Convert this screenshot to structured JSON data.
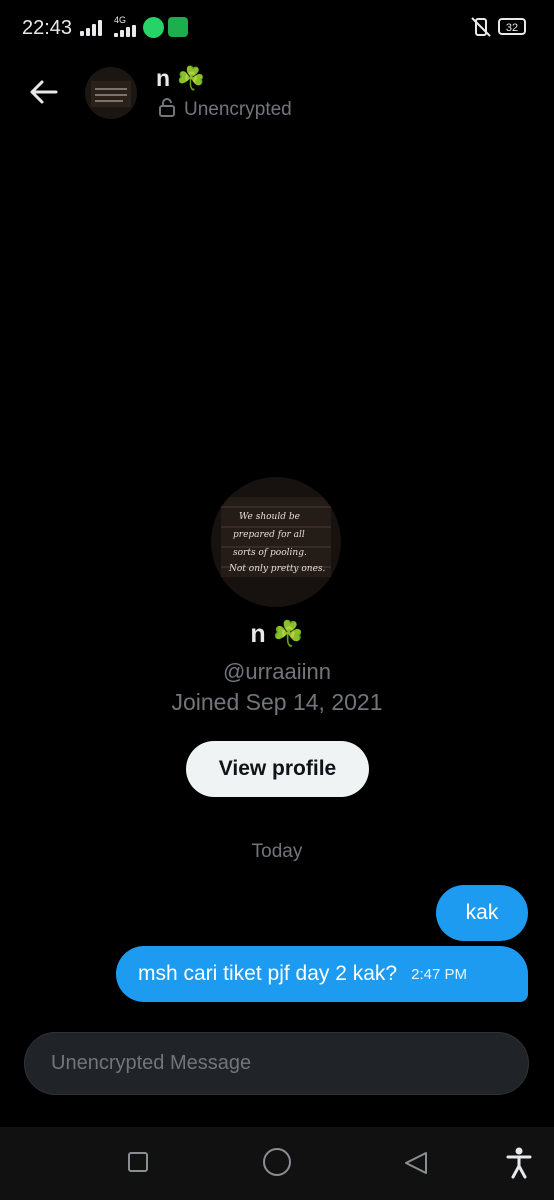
{
  "status_bar": {
    "time": "22:43",
    "network": "4G",
    "battery": "32",
    "icons": [
      "signal-bars-icon",
      "whatsapp-icon",
      "shield-app-icon",
      "mute-vibrate-icon",
      "battery-icon"
    ]
  },
  "header": {
    "name": "n ☘️",
    "encryption_status": "Unencrypted"
  },
  "profile": {
    "name": "n ☘️",
    "handle": "@urraaiinn",
    "joined": "Joined Sep 14, 2021",
    "view_profile_label": "View profile",
    "avatar_text": [
      "We should be",
      "prepared for all",
      "sorts of pooling.",
      "Not only pretty ones."
    ]
  },
  "conversation": {
    "date_divider": "Today",
    "messages": [
      {
        "text": "kak",
        "time": ""
      },
      {
        "text": "msh cari tiket pjf day 2 kak?",
        "time": "2:47 PM"
      }
    ]
  },
  "composer": {
    "placeholder": "Unencrypted Message"
  },
  "colors": {
    "background": "#000000",
    "bubble": "#1d9bf0",
    "muted_text": "#71767b"
  }
}
